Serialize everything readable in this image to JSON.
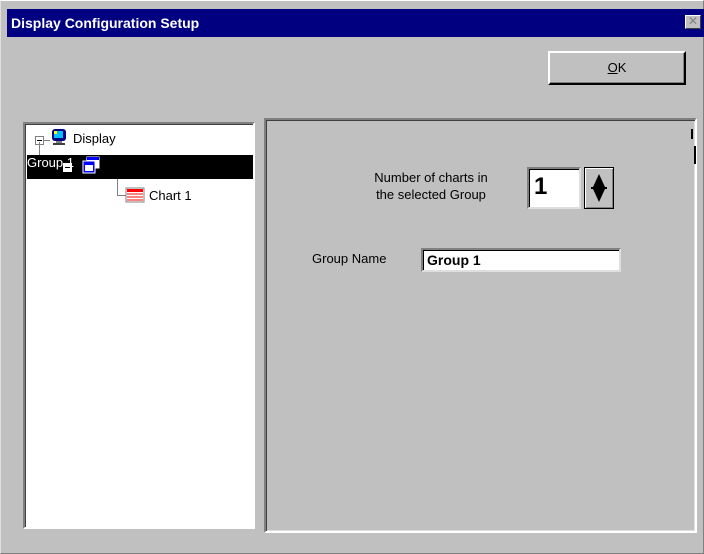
{
  "window": {
    "title": "Display Configuration  Setup",
    "close_glyph": "✕"
  },
  "buttons": {
    "ok_label_mnemonic": "O",
    "ok_label_rest": "K"
  },
  "tree": {
    "root": {
      "label": "Display",
      "icon": "monitor-icon",
      "expanded": true
    },
    "group": {
      "label": "Group 1",
      "icon": "window-group-icon",
      "expanded": true,
      "selected": true
    },
    "chart": {
      "label": "Chart 1",
      "icon": "chart-icon"
    }
  },
  "form": {
    "num_charts_label_line1": "Number of charts in",
    "num_charts_label_line2": "the selected Group",
    "num_charts_value": "1",
    "group_name_label": "Group Name",
    "group_name_value": "Group 1"
  },
  "colors": {
    "titlebar": "#000080",
    "face": "#c0c0c0",
    "selection": "#000000"
  }
}
